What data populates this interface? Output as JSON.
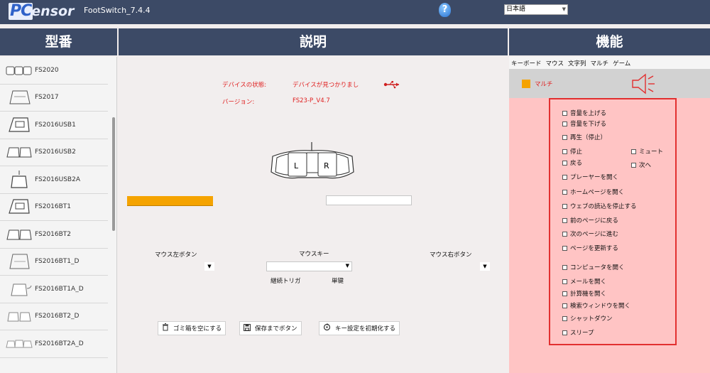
{
  "app": {
    "logo_pc": "PC",
    "logo_rest": "ensor",
    "title": "FootSwitch_7.4.4",
    "help_icon": "help-icon",
    "language": "日本語"
  },
  "headers": {
    "model": "型番",
    "description": "説明",
    "function": "機能"
  },
  "models": [
    "FS2020",
    "FS2017",
    "FS2016USB1",
    "FS2016USB2",
    "FS2016USB2A",
    "FS2016BT1",
    "FS2016BT2",
    "FS2016BT1_D",
    "FS2016BT1A_D",
    "FS2016BT2_D",
    "FS2016BT2A_D"
  ],
  "status": {
    "device_state_label": "デバイスの状態:",
    "device_state_value": "デバイスが見つかりまし",
    "version_label": "バージョン:",
    "version_value": "FS23-P_V4.7",
    "usb_icon": "usb-icon"
  },
  "pedal": {
    "left": "L",
    "right": "R"
  },
  "mapping": {
    "left_label": "マウス左ボタン",
    "mid_label": "マウスキー",
    "right_label": "マウス右ボタン",
    "continuous": "継続トリガ",
    "single": "単键"
  },
  "buttons": {
    "trash": "ゴミ箱を空にする",
    "save": "保存までボタン",
    "reset": "キー設定を初期化する"
  },
  "tabs": [
    "キーボード",
    "マウス",
    "文字列",
    "マルチ",
    "ゲーム"
  ],
  "multi_label": "マルチ",
  "options": {
    "vol_up": "音量を上げる",
    "vol_down": "音量を下げる",
    "play": "再生（停止）",
    "stop": "停止",
    "mute": "ミュート",
    "back": "戻る",
    "next": "次へ",
    "open_player": "プレーヤーを開く",
    "open_home": "ホームページを開く",
    "stop_web": "ウェブの読込を停止する",
    "prev_page": "前のページに戻る",
    "next_page": "次のページに進む",
    "refresh": "ページを更新する",
    "open_computer": "コンピュータを開く",
    "open_mail": "メールを開く",
    "open_calc": "計算機を開く",
    "open_search": "検索ウィンドウを開く",
    "shutdown": "シャットダウン",
    "sleep": "スリープ"
  },
  "colors": {
    "header_bg": "#3c4a66",
    "accent_orange": "#f5a300",
    "function_bg": "#ffc4c4",
    "status_red": "#e02020",
    "highlight_border": "#e23030"
  }
}
